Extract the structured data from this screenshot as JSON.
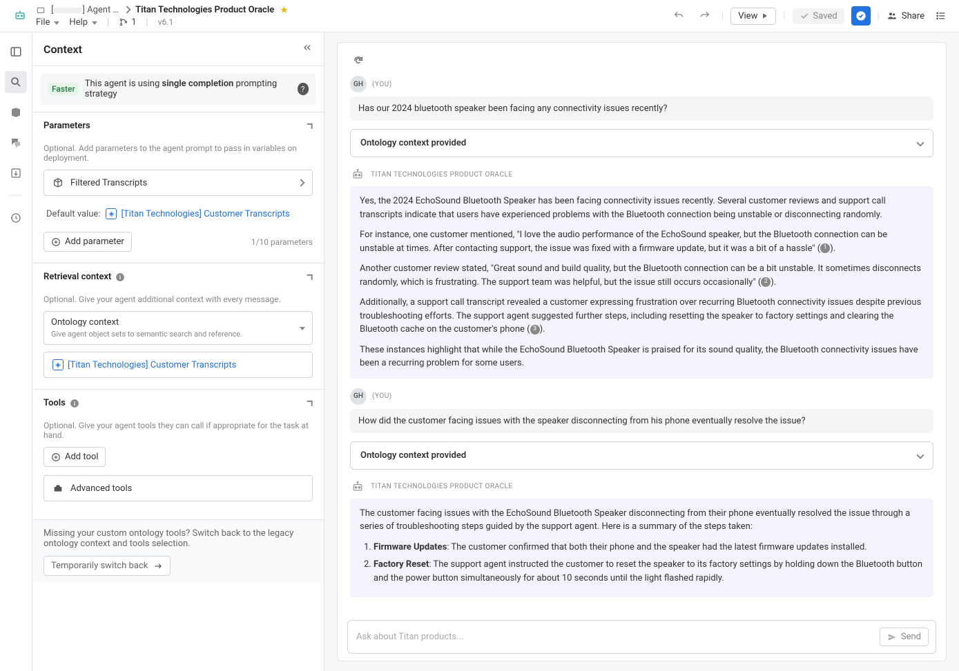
{
  "topbar": {
    "file_icon": "file",
    "crumb1": "[",
    "crumb1b": "] Agent …",
    "crumb2": "Titan Technologies Product Oracle",
    "file_menu": "File",
    "help_menu": "Help",
    "branch_count": "1",
    "version": "v6.1",
    "view_label": "View",
    "saved_label": "Saved",
    "share_label": "Share"
  },
  "context": {
    "title": "Context",
    "banner": {
      "badge": "Faster",
      "text_prefix": "This agent is using ",
      "text_strong": "single completion",
      "text_suffix": " prompting strategy"
    },
    "parameters": {
      "heading": "Parameters",
      "hint": "Optional. Add parameters to the agent prompt to pass in variables on deployment.",
      "filtered_label": "Filtered Transcripts",
      "default_label": "Default value:",
      "default_link": "[Titan Technologies] Customer Transcripts",
      "add_label": "Add parameter",
      "count": "1/10 parameters"
    },
    "retrieval": {
      "heading": "Retrieval context",
      "hint": "Optional. Give your agent additional context with every message.",
      "select_title": "Ontology context",
      "select_sub": "Give agent object sets to semantic search and reference.",
      "ref_link": "[Titan Technologies] Customer Transcripts"
    },
    "tools": {
      "heading": "Tools",
      "hint": "Optional. Give your agent tools they can call if appropriate for the task at hand.",
      "add_tool": "Add tool",
      "advanced": "Advanced tools"
    },
    "legacy": {
      "note": "Missing your custom ontology tools? Switch back to the legacy ontology context and tools selection.",
      "switch_label": "Temporarily switch back"
    }
  },
  "chat": {
    "user_initials": "GH",
    "you_label": "(YOU)",
    "user_msg1": "Has our 2024 bluetooth speaker been facing any connectivity issues recently?",
    "ontology_card": "Ontology context provided",
    "bot_name": "TITAN TECHNOLOGIES PRODUCT ORACLE",
    "bot1": {
      "p1": "Yes, the 2024 EchoSound Bluetooth Speaker has been facing connectivity issues recently. Several customer reviews and support call transcripts indicate that users have experienced problems with the Bluetooth connection being unstable or disconnecting randomly.",
      "p2a": "For instance, one customer mentioned, \"I love the audio performance of the EchoSound speaker, but the Bluetooth connection can be unstable at times. After contacting support, the issue was fixed with a firmware update, but it was a bit of a hassle\" (",
      "p2b": ").",
      "p3a": "Another customer review stated, \"Great sound and build quality, but the Bluetooth connection can be a bit unstable. It sometimes disconnects randomly, which is frustrating. The support team was helpful, but the issue still occurs occasionally\" (",
      "p3b": ").",
      "p4a": "Additionally, a support call transcript revealed a customer expressing frustration over recurring Bluetooth connectivity issues despite previous troubleshooting efforts. The support agent suggested further steps, including resetting the speaker to factory settings and clearing the Bluetooth cache on the customer's phone (",
      "p4b": ").",
      "p5": "These instances highlight that while the EchoSound Bluetooth Speaker is praised for its sound quality, the Bluetooth connectivity issues have been a recurring problem for some users."
    },
    "user_msg2": "How did the customer facing issues with the speaker disconnecting from his phone eventually resolve the issue?",
    "bot2": {
      "p1": "The customer facing issues with the EchoSound Bluetooth Speaker disconnecting from their phone eventually resolved the issue through a series of troubleshooting steps guided by the support agent. Here is a summary of the steps taken:",
      "li1_strong": "Firmware Updates",
      "li1_rest": ": The customer confirmed that both their phone and the speaker had the latest firmware updates installed.",
      "li2_strong": "Factory Reset",
      "li2_rest": ": The support agent instructed the customer to reset the speaker to its factory settings by holding down the Bluetooth button and the power button simultaneously for about 10 seconds until the light flashed rapidly."
    },
    "input_placeholder": "Ask about Titan products...",
    "send_label": "Send",
    "ref1": "1",
    "ref2": "2",
    "ref3": "3"
  }
}
